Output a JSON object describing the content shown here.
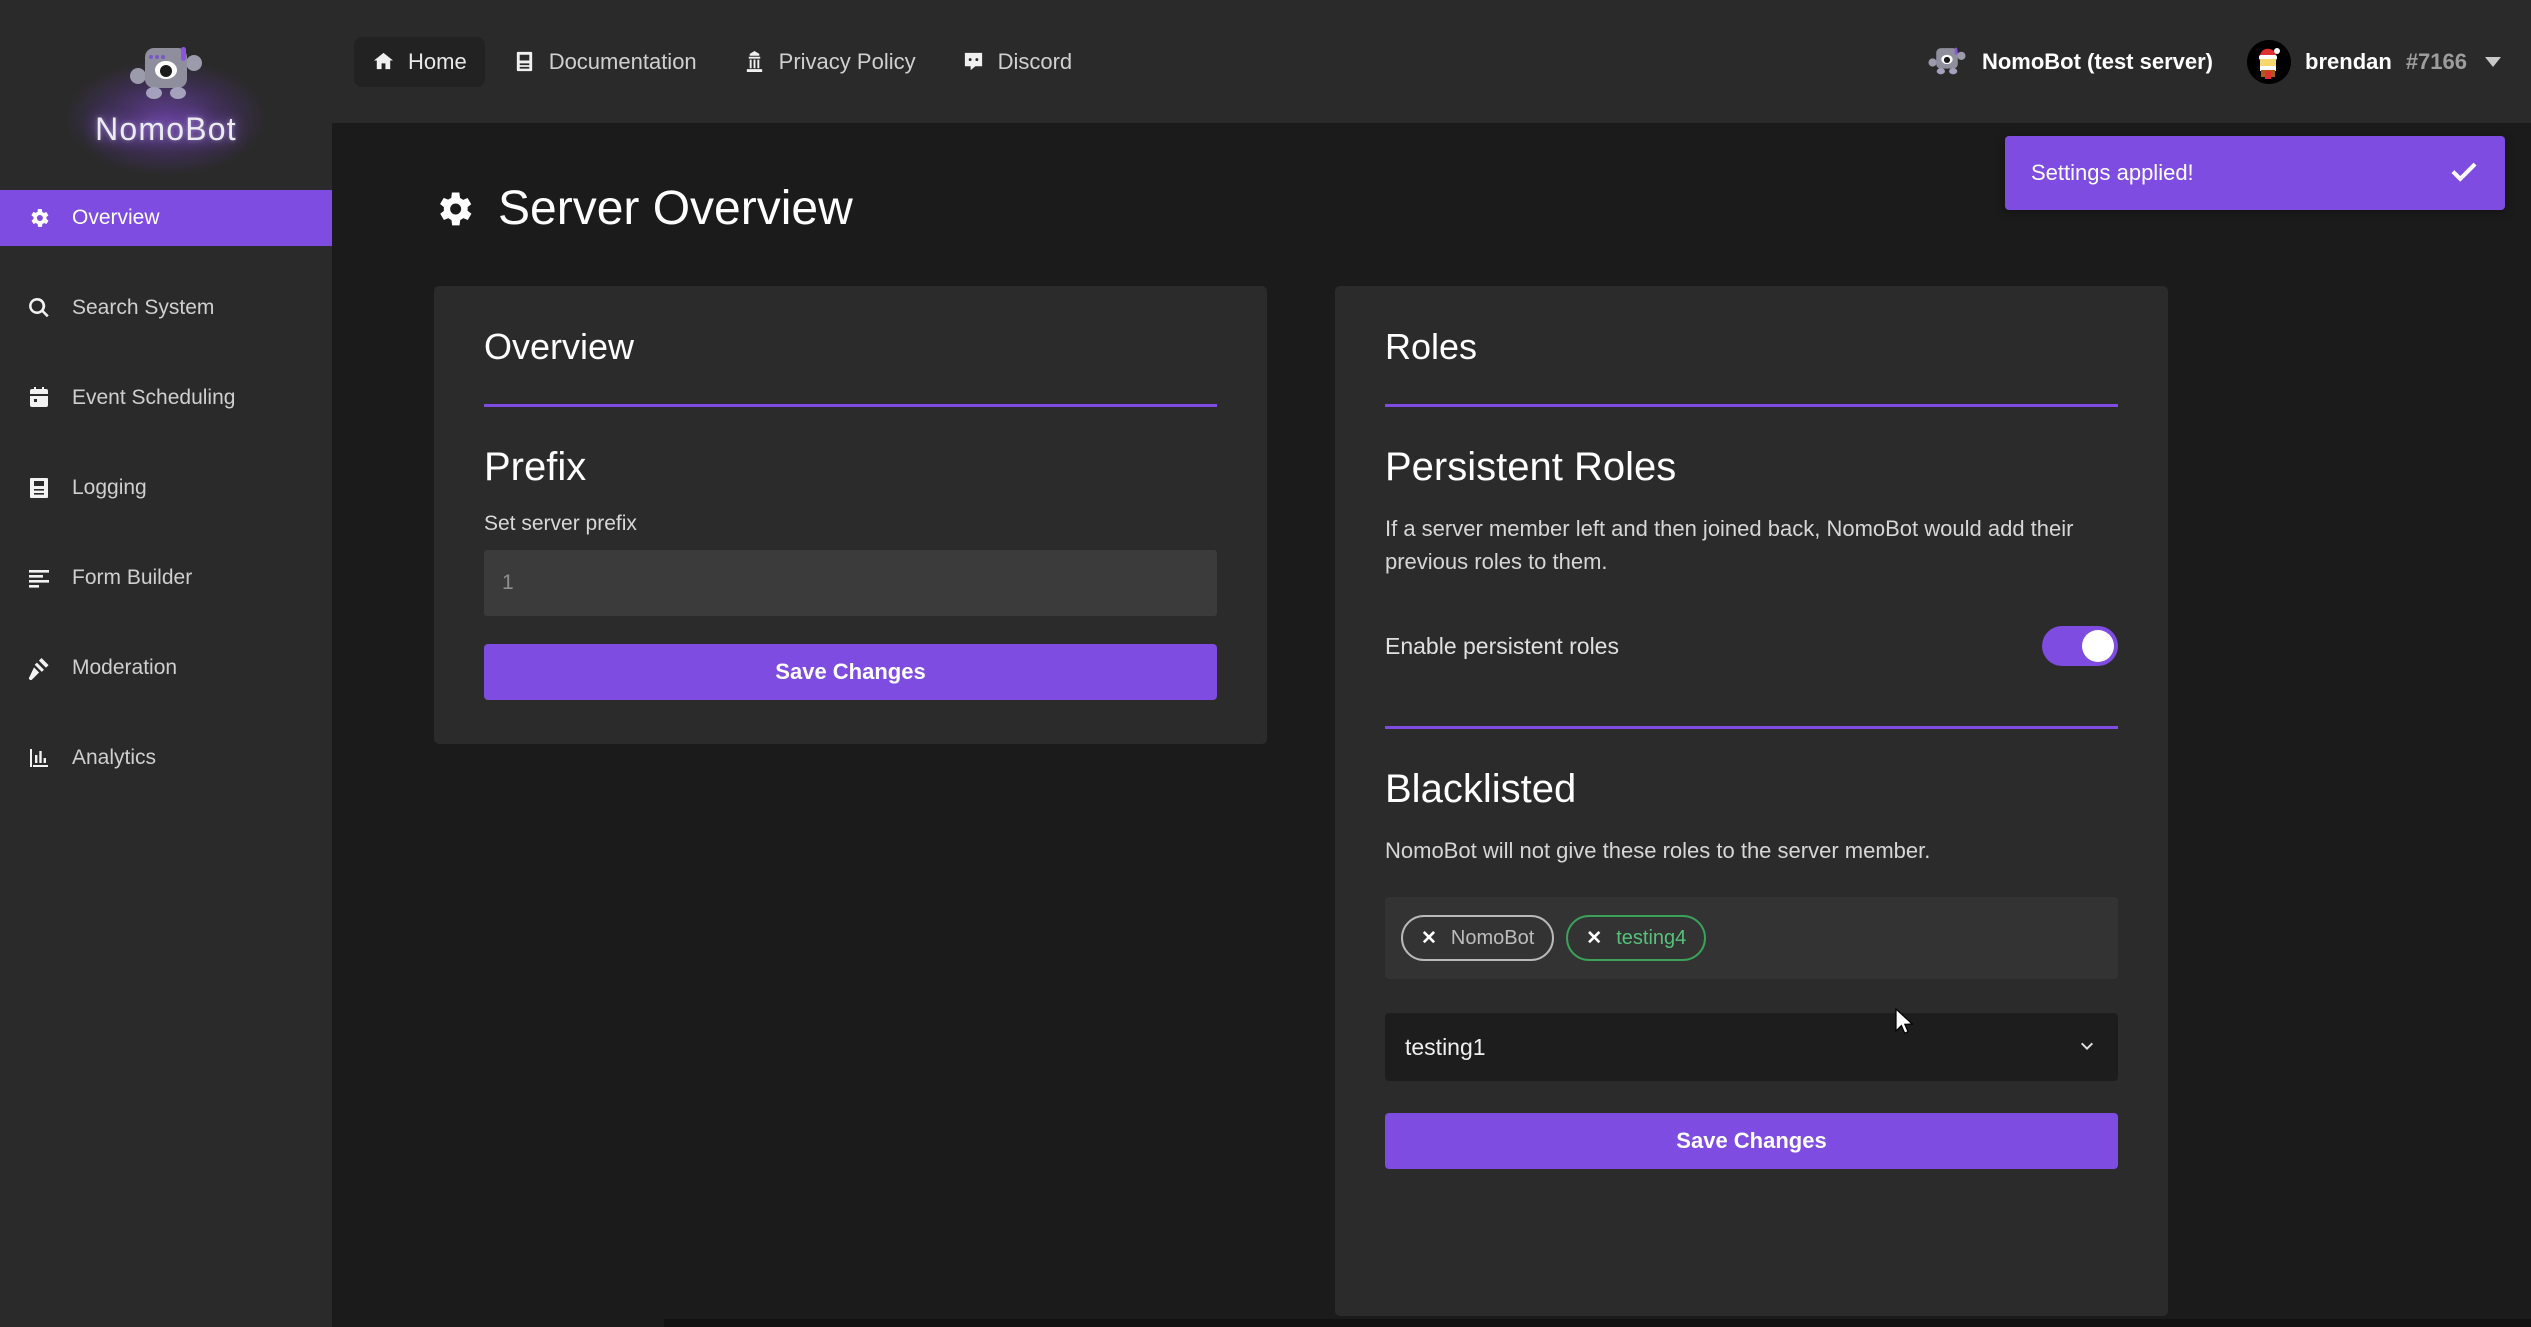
{
  "sidebar": {
    "brand": {
      "name": "NomoBot",
      "logo_icon": "robot-icon"
    },
    "items": [
      {
        "label": "Overview",
        "icon": "gear-icon",
        "active": true
      },
      {
        "label": "Search System",
        "icon": "search-icon",
        "active": false
      },
      {
        "label": "Event Scheduling",
        "icon": "calendar-icon",
        "active": false
      },
      {
        "label": "Logging",
        "icon": "log-book-icon",
        "active": false
      },
      {
        "label": "Form Builder",
        "icon": "list-lines-icon",
        "active": false
      },
      {
        "label": "Moderation",
        "icon": "gavel-icon",
        "active": false
      },
      {
        "label": "Analytics",
        "icon": "bar-chart-icon",
        "active": false
      }
    ]
  },
  "topbar": {
    "nav": [
      {
        "label": "Home",
        "icon": "home-icon",
        "active": true
      },
      {
        "label": "Documentation",
        "icon": "book-icon",
        "active": false
      },
      {
        "label": "Privacy Policy",
        "icon": "building-icon",
        "active": false
      },
      {
        "label": "Discord",
        "icon": "discord-icon",
        "active": false
      }
    ],
    "server": {
      "name": "NomoBot (test server)",
      "icon": "robot-icon"
    },
    "user": {
      "name": "brendan",
      "discriminator": "#7166",
      "avatar": "santa-avatar",
      "caret": "chevron-down-icon"
    }
  },
  "toast": {
    "message": "Settings applied!",
    "icon": "check-icon",
    "color": "#7e4ce0"
  },
  "page": {
    "title": "Server Overview",
    "icon": "gear-icon"
  },
  "overview_card": {
    "title": "Overview",
    "prefix": {
      "heading": "Prefix",
      "label": "Set server prefix",
      "input_value": "",
      "input_placeholder": "1"
    },
    "save_label": "Save Changes"
  },
  "roles_card": {
    "title": "Roles",
    "persistent": {
      "heading": "Persistent Roles",
      "description": "If a server member left and then joined back, NomoBot would add their previous roles to them.",
      "toggle_label": "Enable persistent roles",
      "toggle_on": true
    },
    "blacklisted": {
      "heading": "Blacklisted",
      "description": "NomoBot will not give these roles to the server member.",
      "tags": [
        {
          "label": "NomoBot",
          "color": "#bdbdbd",
          "remove_icon": "close-icon"
        },
        {
          "label": "testing4",
          "color": "#57c07b",
          "remove_icon": "close-icon"
        }
      ],
      "select_value": "testing1",
      "select_caret": "chevron-down-icon",
      "save_label": "Save Changes"
    }
  },
  "colors": {
    "accent": "#7e4ce0",
    "sidebar_bg": "#2a2a2a",
    "card_bg": "#2b2b2b",
    "page_bg": "#1b1b1b",
    "green": "#57c07b"
  }
}
